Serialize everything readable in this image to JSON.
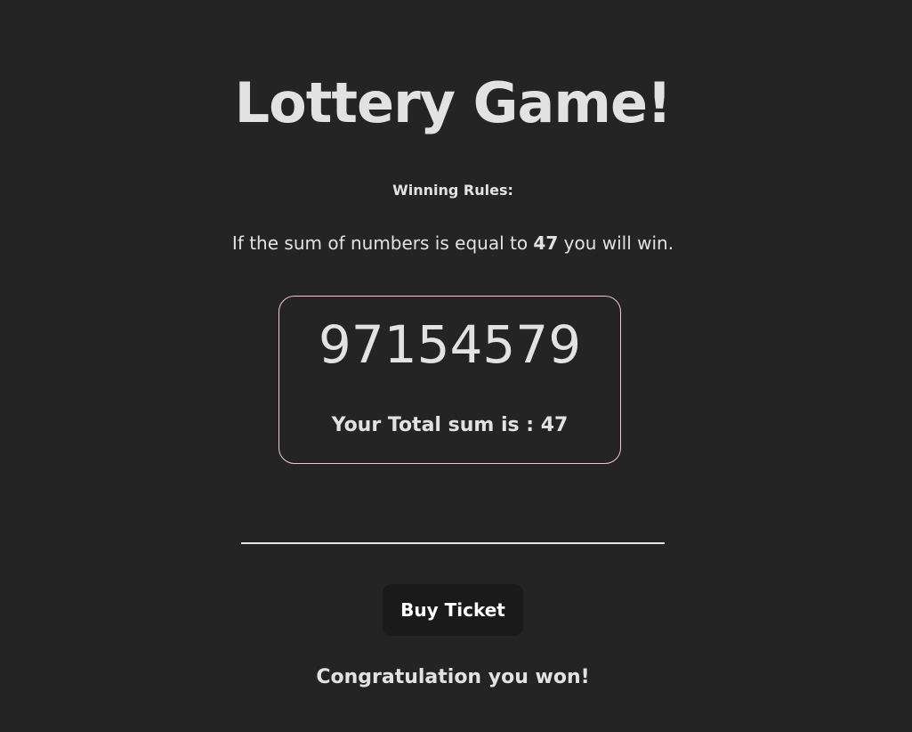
{
  "page": {
    "title": "Lottery Game!"
  },
  "rules": {
    "heading": "Winning Rules:",
    "text_before": "If the sum of numbers is equal to ",
    "target_sum": "47",
    "text_after": " you will win."
  },
  "ticket": {
    "number": "97154579",
    "total_label": "Your Total sum is : ",
    "total_value": "47"
  },
  "actions": {
    "buy_label": "Buy Ticket"
  },
  "result": {
    "message": "Congratulation you won!"
  },
  "colors": {
    "background": "#242424",
    "text": "#dedede",
    "card_border": "#f3c6d6",
    "button_background": "#1a1a1a",
    "divider": "#e6e6e6"
  }
}
